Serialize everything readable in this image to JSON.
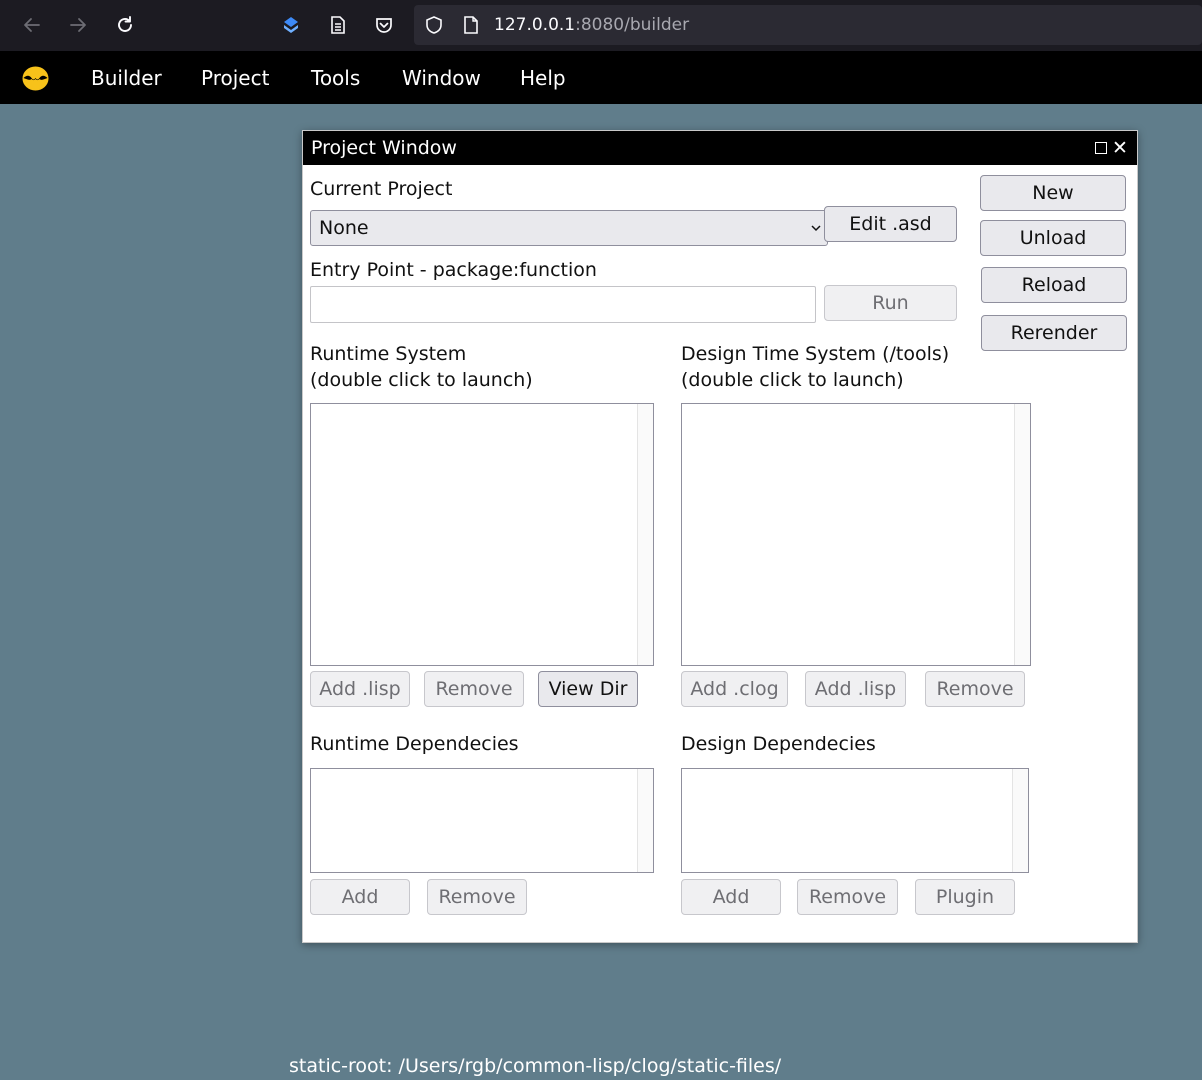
{
  "browser": {
    "url_host": "127.0.0.1",
    "url_rest": ":8080/builder"
  },
  "menubar": {
    "items": [
      "Builder",
      "Project",
      "Tools",
      "Window",
      "Help"
    ]
  },
  "project_window": {
    "title": "Project Window",
    "current_project_label": "Current Project",
    "current_project_value": "None",
    "edit_asd_button": "Edit .asd",
    "entry_point_label": "Entry Point - package:function",
    "entry_point_value": "",
    "run_button": "Run",
    "side_buttons": [
      "New",
      "Unload",
      "Reload",
      "Rerender"
    ],
    "runtime_system_label": "Runtime System",
    "runtime_system_hint": "(double click to launch)",
    "design_time_label": "Design Time System (/tools)",
    "design_time_hint": "(double click to launch)",
    "runtime_buttons": [
      "Add .lisp",
      "Remove",
      "View Dir"
    ],
    "design_buttons": [
      "Add .clog",
      "Add .lisp",
      "Remove"
    ],
    "runtime_deps_label": "Runtime Dependecies",
    "design_deps_label": "Design Dependecies",
    "runtime_deps_buttons": [
      "Add",
      "Remove"
    ],
    "design_deps_buttons": [
      "Add",
      "Remove",
      "Plugin"
    ]
  },
  "footer": {
    "static_root": "static-root: /Users/rgb/common-lisp/clog/static-files/"
  }
}
